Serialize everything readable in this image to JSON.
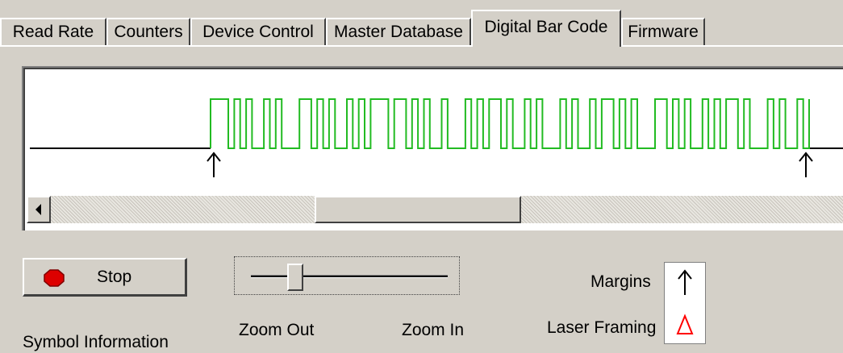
{
  "tabs": [
    {
      "label": "Read Rate"
    },
    {
      "label": "Counters"
    },
    {
      "label": "Device Control"
    },
    {
      "label": "Master Database"
    },
    {
      "label": "Digital Bar Code"
    },
    {
      "label": "Firmware"
    }
  ],
  "active_tab": "Digital Bar Code",
  "colors": {
    "waveform": "#22bb22",
    "baseline": "#000000",
    "laser_framing": "#ff0000",
    "stop_icon": "#dd0000"
  },
  "controls": {
    "stop_label": "Stop",
    "zoom_out_label": "Zoom Out",
    "zoom_in_label": "Zoom In",
    "zoom_level_fraction": 0.2,
    "scroll_position_fraction": 0.45
  },
  "legend": {
    "margins_label": "Margins",
    "laser_framing_label": "Laser Framing",
    "margins_icon": "up-arrow-icon",
    "laser_framing_icon": "red-triangle-icon"
  },
  "symbol_information_label": "Symbol Information"
}
